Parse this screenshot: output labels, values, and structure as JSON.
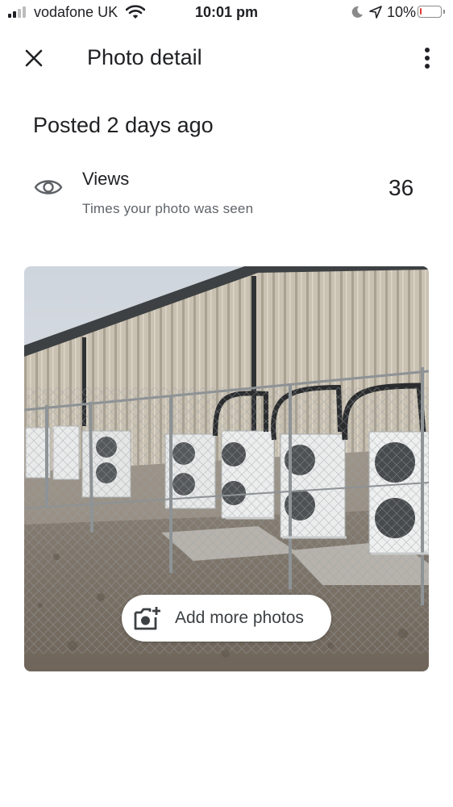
{
  "status_bar": {
    "carrier": "vodafone UK",
    "time": "10:01 pm",
    "battery": "10%",
    "battery_level": 0.1,
    "signal_bars_filled": 2,
    "signal_bars_total": 4
  },
  "app_bar": {
    "title": "Photo detail",
    "icons": [
      "close-icon",
      "more-vert-icon"
    ]
  },
  "posted": "Posted 2 days ago",
  "views": {
    "label": "Views",
    "sublabel": "Times your photo was seen",
    "count": "36",
    "icon": "eye-icon"
  },
  "photo": {
    "add_more_label": "Add more photos",
    "add_icon": "add-photo-icon"
  },
  "colors": {
    "text_primary": "#202124",
    "text_secondary": "#5f6368",
    "battery_low": "#e53935"
  }
}
